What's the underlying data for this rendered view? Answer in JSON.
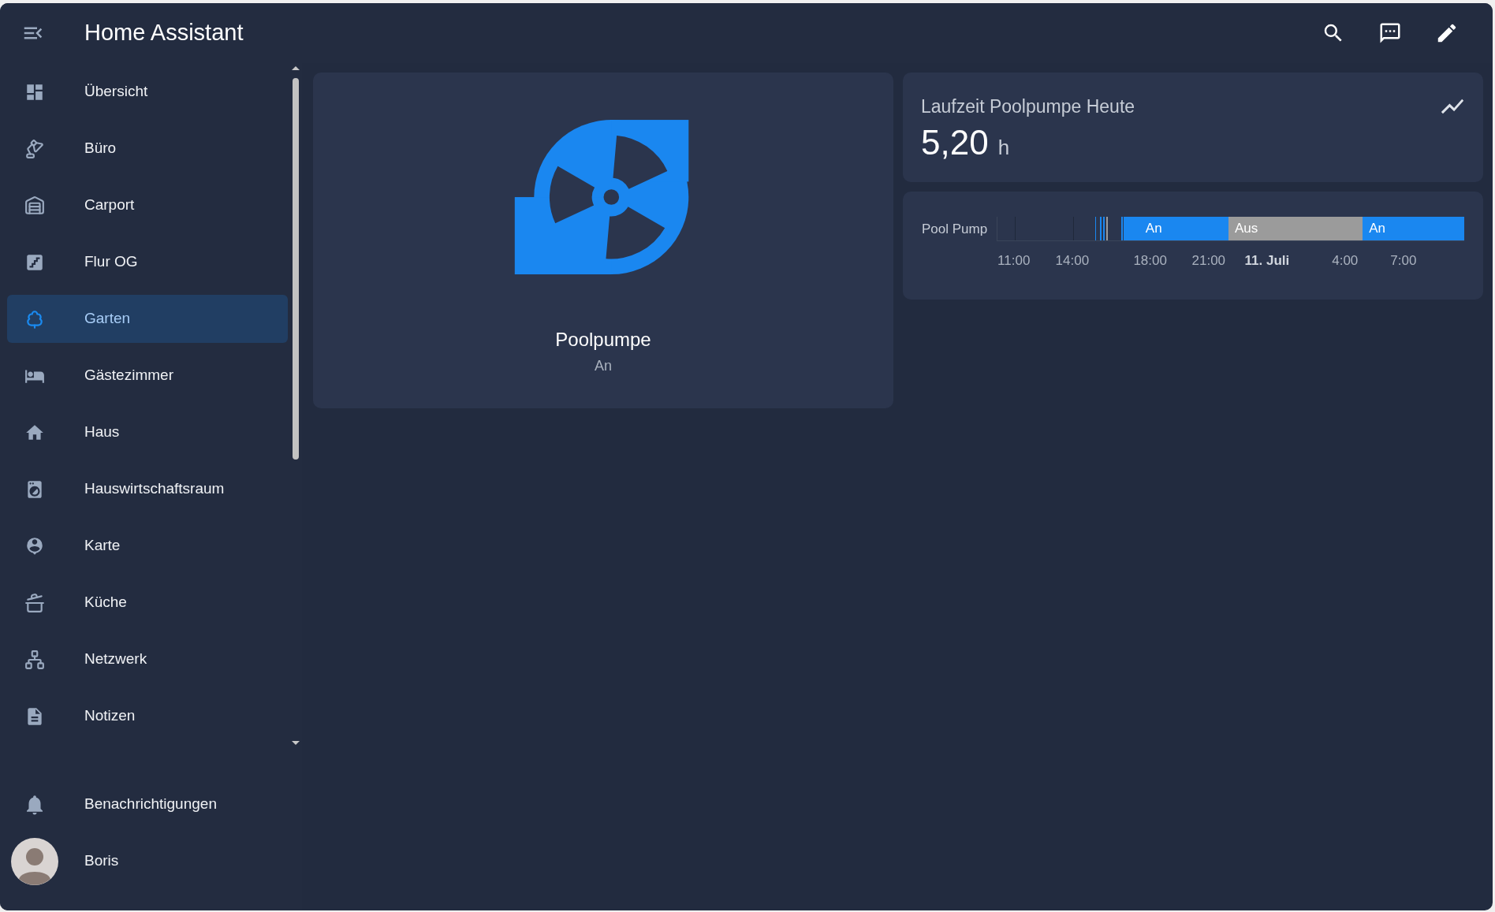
{
  "header": {
    "title": "Home Assistant"
  },
  "sidebar": {
    "items": [
      {
        "label": "Übersicht",
        "selected": false
      },
      {
        "label": "Büro",
        "selected": false
      },
      {
        "label": "Carport",
        "selected": false
      },
      {
        "label": "Flur OG",
        "selected": false
      },
      {
        "label": "Garten",
        "selected": true
      },
      {
        "label": "Gästezimmer",
        "selected": false
      },
      {
        "label": "Haus",
        "selected": false
      },
      {
        "label": "Hauswirtschaftsraum",
        "selected": false
      },
      {
        "label": "Karte",
        "selected": false
      },
      {
        "label": "Küche",
        "selected": false
      },
      {
        "label": "Netzwerk",
        "selected": false
      },
      {
        "label": "Notizen",
        "selected": false
      }
    ],
    "notifications": {
      "label": "Benachrichtigungen"
    },
    "user": {
      "name": "Boris"
    }
  },
  "pump_card": {
    "name": "Poolpumpe",
    "state": "An",
    "on": true
  },
  "sensor_card": {
    "title": "Laufzeit Poolpumpe Heute",
    "value": "5,20",
    "unit": "h"
  },
  "history_card": {
    "entity": "Pool Pump",
    "segments": [
      {
        "label": "An",
        "kind": "on"
      },
      {
        "label": "Aus",
        "kind": "off"
      },
      {
        "label": "An",
        "kind": "on"
      }
    ],
    "axis_labels": [
      {
        "label": "11:00",
        "kind": "time"
      },
      {
        "label": "14:00",
        "kind": "time"
      },
      {
        "label": "18:00",
        "kind": "time"
      },
      {
        "label": "21:00",
        "kind": "time"
      },
      {
        "label": "11. Juli",
        "kind": "date"
      },
      {
        "label": "4:00",
        "kind": "time"
      },
      {
        "label": "7:00",
        "kind": "time"
      }
    ]
  }
}
